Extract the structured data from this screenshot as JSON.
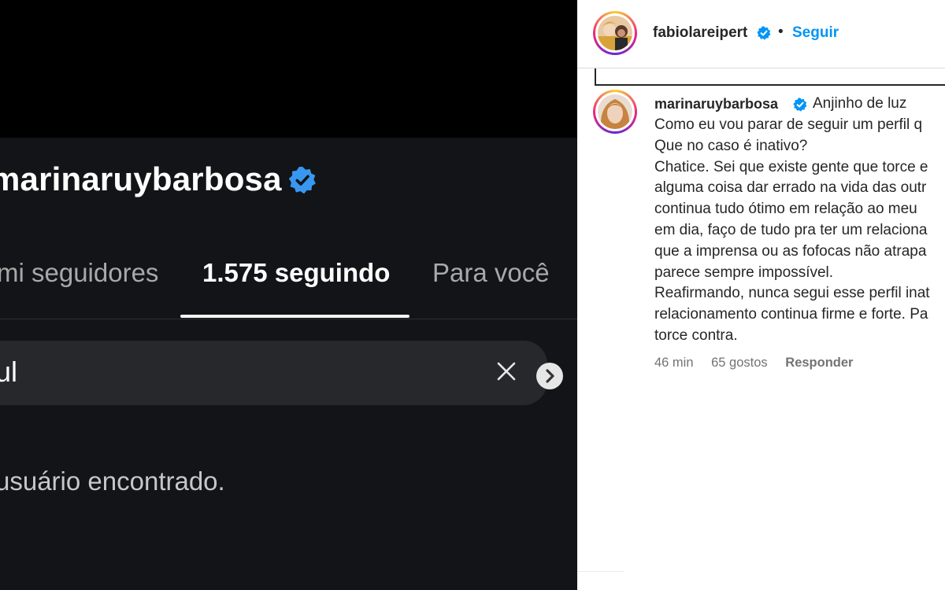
{
  "left_app": {
    "profile_username": "marinaruybarbosa",
    "tabs": {
      "followers": "mi seguidores",
      "following": "1.575 seguindo",
      "for_you": "Para você"
    },
    "search": {
      "value": "ul"
    },
    "empty_message": "usuário encontrado."
  },
  "post": {
    "author": "fabiolareipert",
    "follow_label": "Seguir",
    "separator": "•"
  },
  "comment": {
    "username": "marinaruybarbosa",
    "text_first": "Anjinho de luz",
    "lines": [
      "Como eu vou parar de seguir um perfil q",
      "Que no caso é inativo?",
      "Chatice. Sei que existe gente que torce e",
      "alguma coisa dar errado na vida das outr",
      "continua tudo ótimo em relação ao meu",
      "em dia, faço de tudo pra ter um relaciona",
      "que a imprensa ou as fofocas não atrapa",
      "parece sempre impossível.",
      "Reafirmando, nunca segui esse perfil inat",
      "relacionamento continua firme e forte. Pa",
      "torce contra."
    ],
    "time": "46 min",
    "likes": "65 gostos",
    "reply": "Responder"
  },
  "icons": {
    "verified": "verified-badge-icon",
    "clear": "close-icon",
    "next": "chevron-right-icon"
  },
  "colors": {
    "dark_bg": "#121417",
    "verified_blue": "#0095f6",
    "link_blue": "#0095f6"
  }
}
